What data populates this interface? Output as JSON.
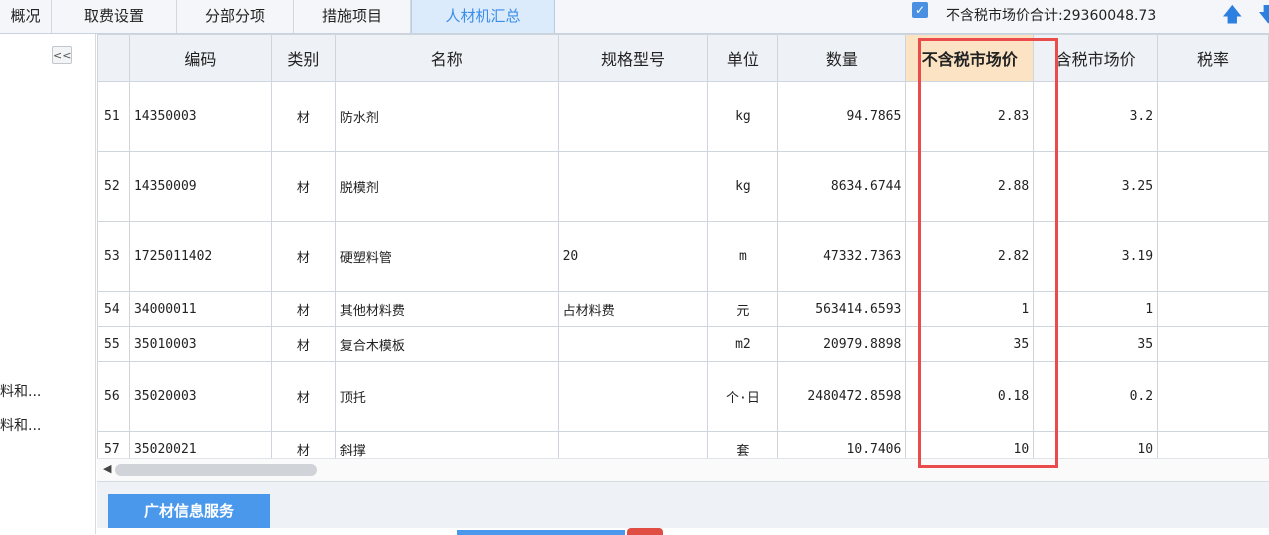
{
  "tabs": [
    {
      "label": "概况"
    },
    {
      "label": "取费设置"
    },
    {
      "label": "分部分项"
    },
    {
      "label": "措施项目"
    },
    {
      "label": "人材机汇总"
    }
  ],
  "topbar": {
    "checkbox_label": "不含税市场价合计:29360048.73",
    "up_icon": "arrow-up-icon",
    "down_icon": "arrow-down-icon"
  },
  "leftpanel": {
    "collapse_label": "<<",
    "items": [
      "料和...",
      "料和..."
    ]
  },
  "table": {
    "headers": [
      "编码",
      "类别",
      "名称",
      "规格型号",
      "单位",
      "数量",
      "不含税市场价",
      "含税市场价",
      "税率"
    ],
    "rows": [
      {
        "no": "51",
        "code": "14350003",
        "type": "材",
        "name": "防水剂",
        "spec": "",
        "unit": "kg",
        "qty": "94.7865",
        "price_ex": "2.83",
        "price_in": "3.2"
      },
      {
        "no": "52",
        "code": "14350009",
        "type": "材",
        "name": "脱模剂",
        "spec": "",
        "unit": "kg",
        "qty": "8634.6744",
        "price_ex": "2.88",
        "price_in": "3.25"
      },
      {
        "no": "53",
        "code": "1725011402",
        "type": "材",
        "name": "硬塑料管",
        "spec": "20",
        "unit": "m",
        "qty": "47332.7363",
        "price_ex": "2.82",
        "price_in": "3.19"
      },
      {
        "no": "54",
        "code": "34000011",
        "type": "材",
        "name": "其他材料费",
        "spec": "占材料费",
        "unit": "元",
        "qty": "563414.6593",
        "price_ex": "1",
        "price_in": "1"
      },
      {
        "no": "55",
        "code": "35010003",
        "type": "材",
        "name": "复合木模板",
        "spec": "",
        "unit": "m2",
        "qty": "20979.8898",
        "price_ex": "35",
        "price_in": "35"
      },
      {
        "no": "56",
        "code": "35020003",
        "type": "材",
        "name": "顶托",
        "spec": "",
        "unit": "个·日",
        "qty": "2480472.8598",
        "price_ex": "0.18",
        "price_in": "0.2"
      },
      {
        "no": "57",
        "code": "35020021",
        "type": "材",
        "name": "斜撑",
        "spec": "",
        "unit": "套",
        "qty": "10.7406",
        "price_ex": "10",
        "price_in": "10"
      }
    ]
  },
  "bottom": {
    "service_tab": "广材信息服务"
  },
  "colors": {
    "accent": "#4a98ec",
    "highlight_header": "#fbe3c4",
    "annotation_red": "#ea4b4b"
  }
}
